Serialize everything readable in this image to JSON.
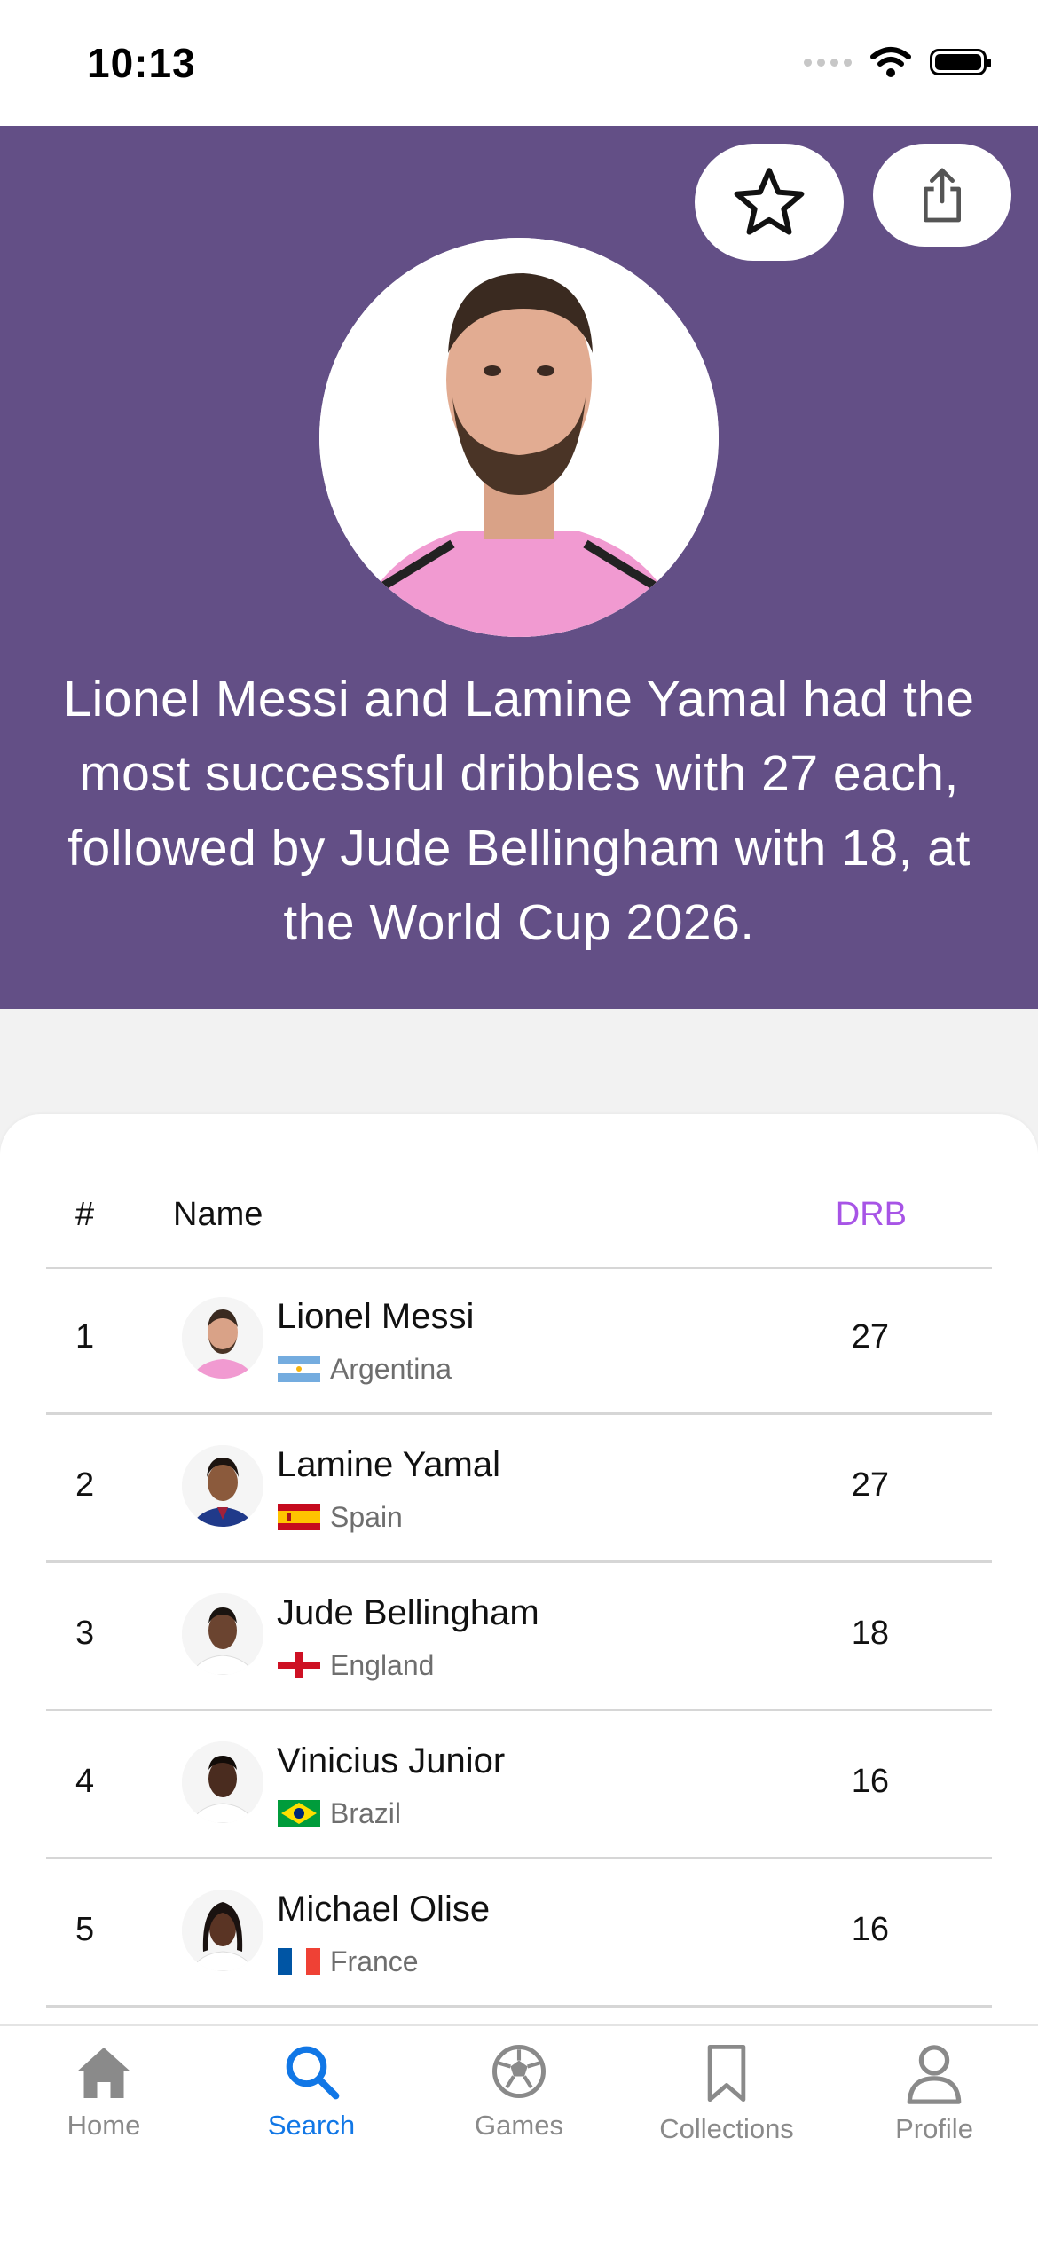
{
  "status_bar": {
    "time": "10:13"
  },
  "hero": {
    "description": "Lionel Messi and Lamine Yamal had the most successful dribbles with 27 each, followed by Jude Bellingham with 18, at the World Cup 2026.",
    "favorite_icon": "star-icon",
    "share_icon": "share-icon"
  },
  "table": {
    "headers": {
      "rank": "#",
      "name": "Name",
      "stat": "DRB"
    },
    "stat_color": "#a754e6",
    "rows": [
      {
        "rank": "1",
        "name": "Lionel Messi",
        "country": "Argentina",
        "value": "27"
      },
      {
        "rank": "2",
        "name": "Lamine Yamal",
        "country": "Spain",
        "value": "27"
      },
      {
        "rank": "3",
        "name": "Jude Bellingham",
        "country": "England",
        "value": "18"
      },
      {
        "rank": "4",
        "name": "Vinicius Junior",
        "country": "Brazil",
        "value": "16"
      },
      {
        "rank": "5",
        "name": "Michael Olise",
        "country": "France",
        "value": "16"
      }
    ]
  },
  "tab_bar": {
    "active": "Search",
    "active_color": "#1177e6",
    "items": [
      {
        "label": "Home",
        "icon": "home-icon"
      },
      {
        "label": "Search",
        "icon": "search-icon"
      },
      {
        "label": "Games",
        "icon": "soccer-ball-icon"
      },
      {
        "label": "Collections",
        "icon": "bookmark-icon"
      },
      {
        "label": "Profile",
        "icon": "person-icon"
      }
    ]
  },
  "colors": {
    "hero_bg": "#634f86",
    "page_bg": "#f2f2f2"
  }
}
